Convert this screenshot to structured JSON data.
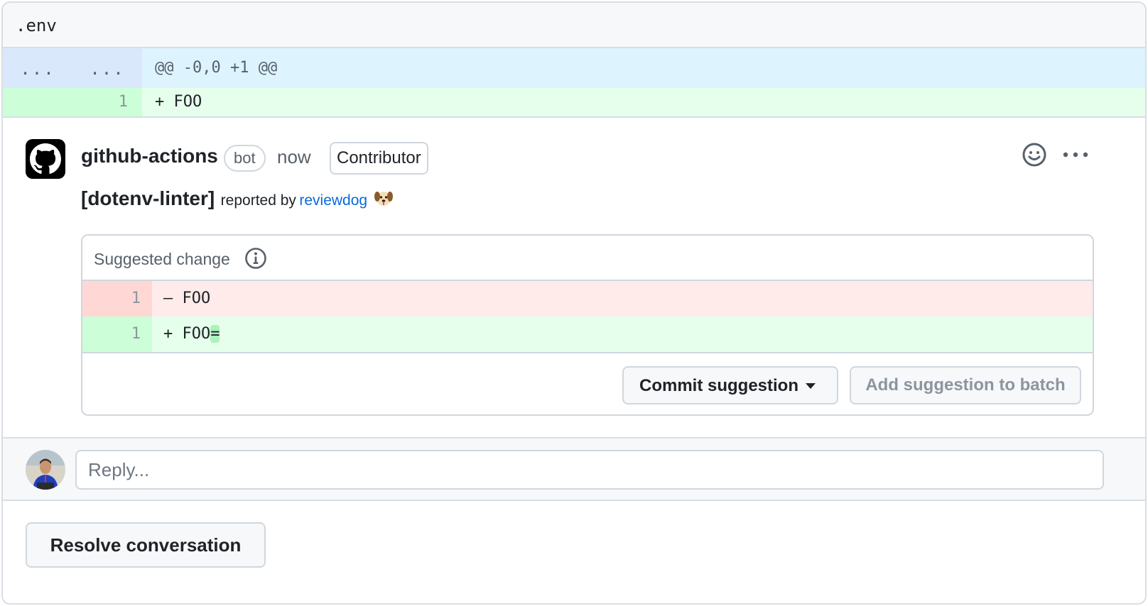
{
  "file": {
    "name": ".env"
  },
  "diff": {
    "hunk": {
      "left_num": "...",
      "right_num": "...",
      "header": "@@ -0,0 +1 @@"
    },
    "lines": [
      {
        "num": "1",
        "code": "+ FOO"
      }
    ]
  },
  "comment": {
    "author": "github-actions",
    "author_badge": "bot",
    "time": "now",
    "role_badge": "Contributor",
    "lint_name": "[dotenv-linter]",
    "reported_by": "reported by",
    "link_text": "reviewdog",
    "icons": {
      "avatar": "github-logo-icon",
      "emoji": "smiley-icon",
      "menu": "kebab-horizontal-icon",
      "mascot": "dog-face-icon"
    }
  },
  "suggestion": {
    "title": "Suggested change",
    "info_icon": "info-icon",
    "deleted": {
      "num": "1",
      "code": "– FOO"
    },
    "added": {
      "num": "1",
      "code_prefix": "+ FOO",
      "code_highlight": "="
    },
    "commit_label": "Commit suggestion",
    "batch_label": "Add suggestion to batch"
  },
  "reply": {
    "placeholder": "Reply..."
  },
  "resolve_label": "Resolve conversation",
  "colors": {
    "accent_link": "#0969da",
    "addition_bg": "#e6ffec",
    "deletion_bg": "#ffebe9",
    "hunk_bg": "#ddf4ff",
    "border": "#d0d7de"
  }
}
